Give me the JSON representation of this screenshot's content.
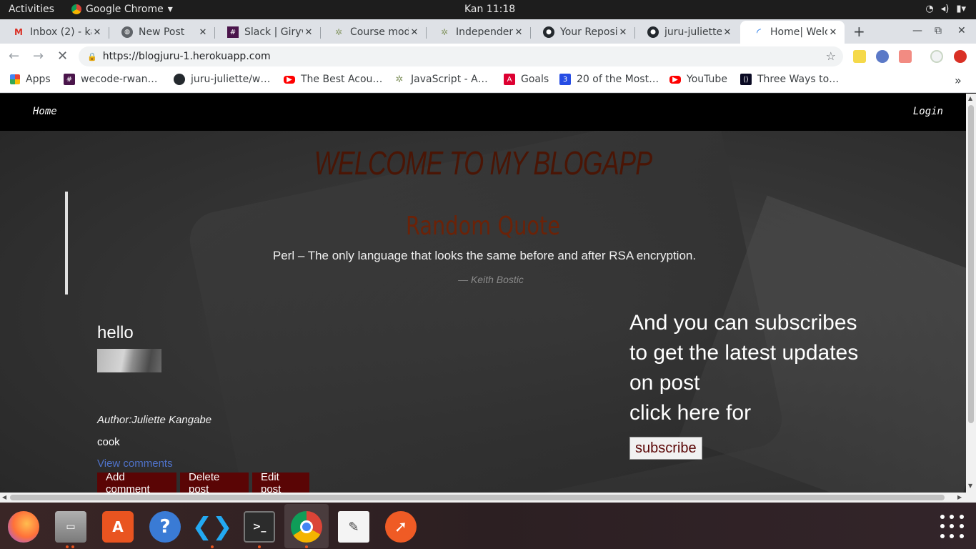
{
  "system": {
    "activities": "Activities",
    "app_name": "Google Chrome",
    "clock": "Kan 11:18"
  },
  "tabs": [
    {
      "title": "Inbox (2) - ka",
      "icon": "gmail-icon"
    },
    {
      "title": "New Post",
      "icon": "globe-icon"
    },
    {
      "title": "Slack | Giryv",
      "icon": "slack-icon"
    },
    {
      "title": "Course mod",
      "icon": "palm-icon"
    },
    {
      "title": "Independen",
      "icon": "palm-icon"
    },
    {
      "title": "Your Reposi",
      "icon": "github-icon"
    },
    {
      "title": "juru-juliette",
      "icon": "github-icon"
    },
    {
      "title": "Home| Welc",
      "icon": "loading-icon"
    }
  ],
  "address_bar": {
    "url": "https://blogjuru-1.herokuapp.com"
  },
  "bookmarks": [
    {
      "label": "Apps",
      "icon": "apps-grid-icon"
    },
    {
      "label": "wecode-rwan…",
      "icon": "slack-icon"
    },
    {
      "label": "juru-juliette/w…",
      "icon": "github-icon"
    },
    {
      "label": "The Best Acou…",
      "icon": "youtube-icon"
    },
    {
      "label": "JavaScript - A…",
      "icon": "palm-icon"
    },
    {
      "label": "Goals",
      "icon": "angular-icon"
    },
    {
      "label": "20 of the Most…",
      "icon": "css3-icon"
    },
    {
      "label": "YouTube",
      "icon": "youtube-icon"
    },
    {
      "label": "Three Ways to…",
      "icon": "freecodecamp-icon"
    }
  ],
  "site": {
    "nav_home": "Home",
    "nav_login": "Login",
    "title": "WELCOME TO MY BLOGAPP",
    "quote_heading": "Random Quote",
    "quote_text": "Perl – The only language that looks the same before and after RSA encryption.",
    "quote_author": "— Keith Bostic"
  },
  "post": {
    "title": "hello",
    "author": "Author:Juliette Kangabe",
    "body": "cook",
    "view_comments": "View comments",
    "add_comment": "Add comment",
    "delete_post": "Delete post",
    "edit_post": "Edit post"
  },
  "subscribe": {
    "line1": "And you can subscribes",
    "line2": "to get the latest updates",
    "line3": "on post",
    "line4": "click here for",
    "button": "subscribe"
  },
  "colors": {
    "site_title": "#4a1505",
    "button_bg": "#5a0505",
    "link": "#4f72c9"
  }
}
